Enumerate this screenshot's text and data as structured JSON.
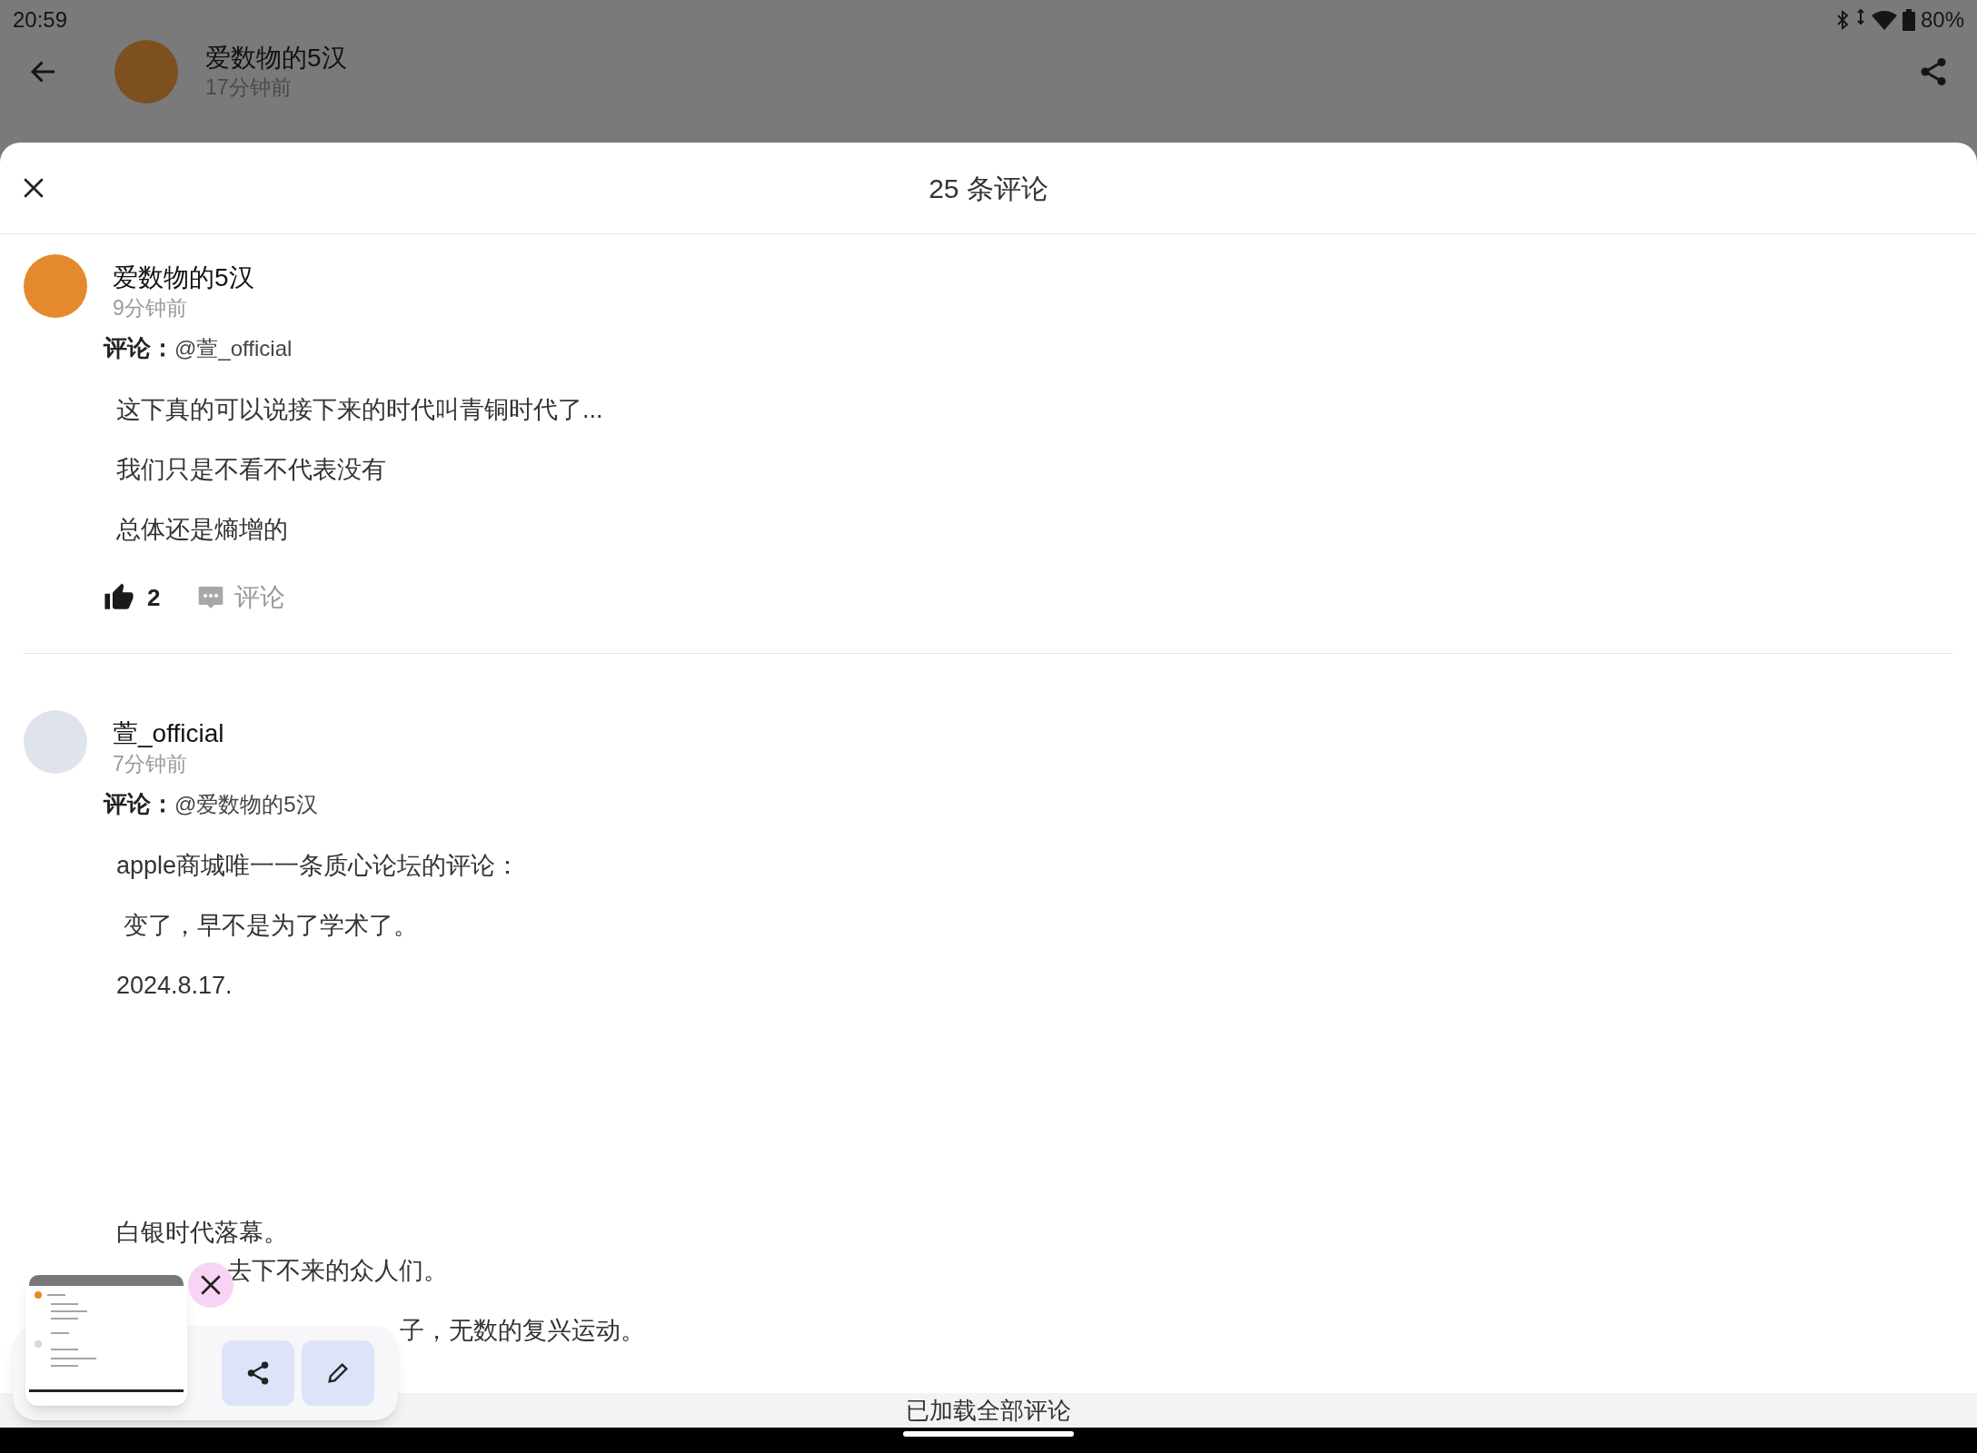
{
  "status_bar": {
    "time": "20:59",
    "battery": "80%"
  },
  "background_post": {
    "author": "爱数物的5汉",
    "time": "17分钟前"
  },
  "sheet": {
    "title": "25 条评论"
  },
  "comments": [
    {
      "author": "爱数物的5汉",
      "time": "9分钟前",
      "reply_label": "评论：",
      "reply_to": "@萱_official",
      "lines": [
        "这下真的可以说接下来的时代叫青铜时代了...",
        "我们只是不看不代表没有",
        "总体还是熵增的"
      ],
      "likes": "2",
      "comment_label": "评论"
    },
    {
      "author": "萱_official",
      "time": "7分钟前",
      "reply_label": "评论：",
      "reply_to": "@爱数物的5汉",
      "lines": [
        "apple商城唯一一条质心论坛的评论：",
        " 变了，早不是为了学术了。",
        "2024.8.17."
      ],
      "more_lines": [
        "白银时代落幕。"
      ],
      "covered_lines": [
        "去下不来的众人们。",
        "子，无数的复兴运动。"
      ]
    }
  ],
  "footer": "已加载全部评论"
}
